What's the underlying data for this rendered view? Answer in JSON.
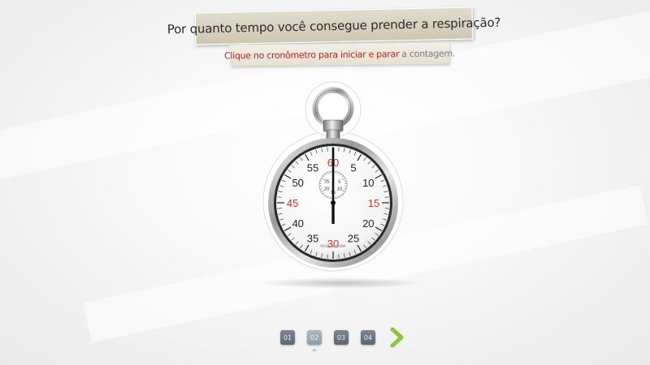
{
  "header": {
    "question": "Por quanto tempo você consegue prender a respiração?",
    "instruction_red": "Clique no cronômetro para iniciar e parar",
    "instruction_gray": "a contagem."
  },
  "stopwatch": {
    "dial_numbers": [
      "60",
      "5",
      "10",
      "15",
      "20",
      "25",
      "30",
      "35",
      "40",
      "45",
      "50",
      "55"
    ],
    "red_numbers": [
      "60",
      "15",
      "30",
      "45"
    ],
    "subdial_numbers": [
      "25",
      "5",
      "20",
      "10",
      "15"
    ],
    "maker_text": "MADE IN CHINA",
    "accent_red": "#c0392b",
    "icon": "stopwatch-icon"
  },
  "pager": {
    "pages": [
      "01",
      "02",
      "03",
      "04"
    ],
    "active": "02",
    "next_icon": "chevron-right-icon",
    "next_color": "#8cc63f"
  }
}
